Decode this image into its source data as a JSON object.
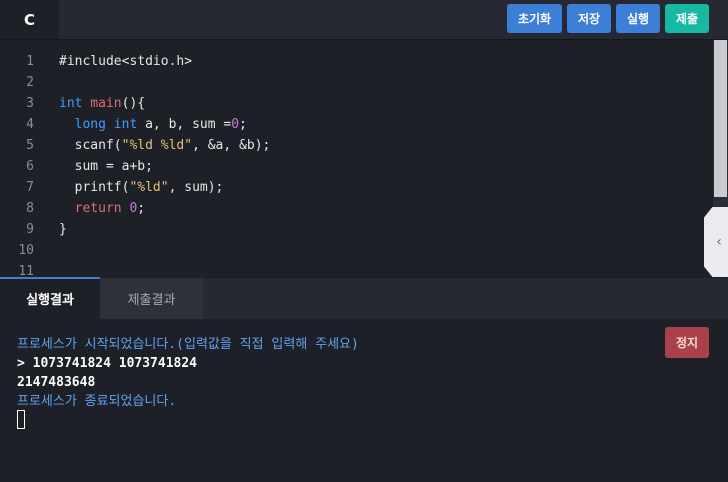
{
  "toolbar": {
    "language": "C",
    "reset_label": "초기화",
    "save_label": "저장",
    "run_label": "실행",
    "submit_label": "제출"
  },
  "editor": {
    "line_numbers": [
      "1",
      "2",
      "3",
      "4",
      "5",
      "6",
      "7",
      "8",
      "9",
      "10",
      "11"
    ],
    "lines": [
      [
        {
          "t": "#include<stdio.h>",
          "c": ""
        }
      ],
      [],
      [
        {
          "t": "int",
          "c": "kw-type"
        },
        {
          "t": " ",
          "c": ""
        },
        {
          "t": "main",
          "c": "kw-fn"
        },
        {
          "t": "(){",
          "c": ""
        }
      ],
      [
        {
          "t": "  ",
          "c": ""
        },
        {
          "t": "long",
          "c": "kw-type"
        },
        {
          "t": " ",
          "c": ""
        },
        {
          "t": "int",
          "c": "kw-type"
        },
        {
          "t": " a, b, sum =",
          "c": ""
        },
        {
          "t": "0",
          "c": "num"
        },
        {
          "t": ";",
          "c": ""
        }
      ],
      [
        {
          "t": "  scanf(",
          "c": ""
        },
        {
          "t": "\"%ld %ld\"",
          "c": "str"
        },
        {
          "t": ", &a, &b);",
          "c": ""
        }
      ],
      [
        {
          "t": "  sum = a+b;",
          "c": ""
        }
      ],
      [
        {
          "t": "  printf(",
          "c": ""
        },
        {
          "t": "\"%ld\"",
          "c": "str"
        },
        {
          "t": ", sum);",
          "c": ""
        }
      ],
      [
        {
          "t": "  ",
          "c": ""
        },
        {
          "t": "return",
          "c": "kw-ret"
        },
        {
          "t": " ",
          "c": ""
        },
        {
          "t": "0",
          "c": "num"
        },
        {
          "t": ";",
          "c": ""
        }
      ],
      [
        {
          "t": "}",
          "c": ""
        }
      ],
      [],
      []
    ]
  },
  "result_tabs": {
    "run_result": "실행결과",
    "submit_result": "제출결과"
  },
  "console": {
    "started": "프로세스가 시작되었습니다.(입력값을 직접 입력해 주세요)",
    "input_line": "> 1073741824 1073741824",
    "output_line": "2147483648",
    "ended": "프로세스가 종료되었습니다.",
    "stop_label": "정지"
  },
  "colors": {
    "primary": "#3d7fd6",
    "submit": "#17b9a3",
    "stop": "#a8414a",
    "console_info": "#5ea2ef"
  }
}
